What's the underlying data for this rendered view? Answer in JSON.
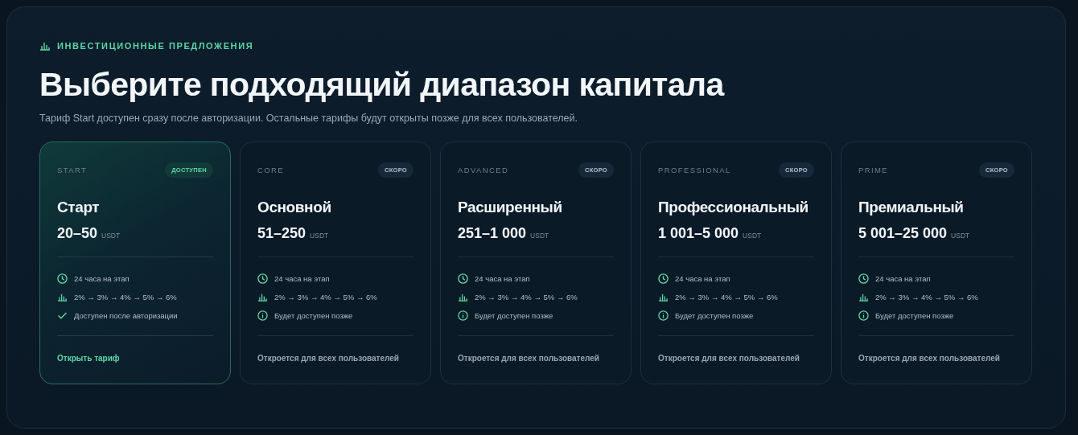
{
  "eyebrow": "ИНВЕСТИЦИОННЫЕ ПРЕДЛОЖЕНИЯ",
  "title": "Выберите подходящий диапазон капитала",
  "subtitle": "Тариф Start доступен сразу после авторизации. Остальные тарифы будут открыты позже для всех пользователей.",
  "plans": [
    {
      "code": "START",
      "badge": "ДОСТУПЕН",
      "available": true,
      "name": "Старт",
      "range": "20–50",
      "currency": "USDT",
      "features": [
        {
          "kind": "clock",
          "text": "24 часа на этап"
        },
        {
          "kind": "chart",
          "text": "2% → 3% → 4% → 5% → 6%"
        },
        {
          "kind": "check",
          "text": "Доступен после авторизации"
        }
      ],
      "action": "Открыть тариф"
    },
    {
      "code": "CORE",
      "badge": "СКОРО",
      "available": false,
      "name": "Основной",
      "range": "51–250",
      "currency": "USDT",
      "features": [
        {
          "kind": "clock",
          "text": "24 часа на этап"
        },
        {
          "kind": "chart",
          "text": "2% → 3% → 4% → 5% → 6%"
        },
        {
          "kind": "info",
          "text": "Будет доступен позже"
        }
      ],
      "action": "Откроется для всех пользователей"
    },
    {
      "code": "ADVANCED",
      "badge": "СКОРО",
      "available": false,
      "name": "Расширенный",
      "range": "251–1 000",
      "currency": "USDT",
      "features": [
        {
          "kind": "clock",
          "text": "24 часа на этап"
        },
        {
          "kind": "chart",
          "text": "2% → 3% → 4% → 5% → 6%"
        },
        {
          "kind": "info",
          "text": "Будет доступен позже"
        }
      ],
      "action": "Откроется для всех пользователей"
    },
    {
      "code": "PROFESSIONAL",
      "badge": "СКОРО",
      "available": false,
      "name": "Профессиональный",
      "range": "1 001–5 000",
      "currency": "USDT",
      "features": [
        {
          "kind": "clock",
          "text": "24 часа на этап"
        },
        {
          "kind": "chart",
          "text": "2% → 3% → 4% → 5% → 6%"
        },
        {
          "kind": "info",
          "text": "Будет доступен позже"
        }
      ],
      "action": "Откроется для всех пользователей"
    },
    {
      "code": "PRIME",
      "badge": "СКОРО",
      "available": false,
      "name": "Премиальный",
      "range": "5 001–25 000",
      "currency": "USDT",
      "features": [
        {
          "kind": "clock",
          "text": "24 часа на этап"
        },
        {
          "kind": "chart",
          "text": "2% → 3% → 4% → 5% → 6%"
        },
        {
          "kind": "info",
          "text": "Будет доступен позже"
        }
      ],
      "action": "Откроется для всех пользователей"
    }
  ]
}
